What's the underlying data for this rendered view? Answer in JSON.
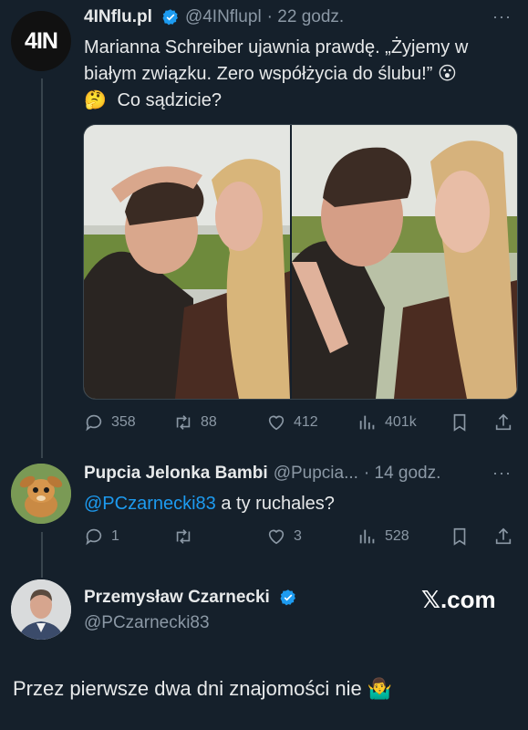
{
  "colors": {
    "background": "#15202b",
    "text": "#e7e9ea",
    "muted": "#8b98a5",
    "accent": "#1d9bf0",
    "thread_line": "#38444d"
  },
  "tweet1": {
    "avatar_text": "4IN",
    "name": "4INflu.pl",
    "verified_icon": "verified-badge-icon",
    "handle": "@4INflupl",
    "time": "· 22 godz.",
    "more": "···",
    "text_line1": "Marianna Schreiber ujawnia prawdę. „Żyjemy w",
    "text_line2": "białym związku. Zero współżycia do ślubu!”",
    "emoji1": "😮",
    "emoji2": "🤔",
    "text_line3": "Co sądzicie?",
    "media_alt": "photo-collage",
    "actions": {
      "replies": "358",
      "retweets": "88",
      "likes": "412",
      "views": "401k"
    }
  },
  "tweet2": {
    "name": "Pupcia Jelonka Bambi",
    "handle": "@Pupcia...",
    "time": "· 14 godz.",
    "more": "···",
    "mention": "@PCzarnecki83",
    "text": " a ty ruchales?",
    "actions": {
      "replies": "1",
      "retweets": "",
      "likes": "3",
      "views": "528"
    }
  },
  "tweet3": {
    "name": "Przemysław Czarnecki",
    "verified_icon": "verified-badge-icon",
    "handle": "@PCzarnecki83",
    "brand": "𝕏.com",
    "text": "Przez pierwsze dwa dni znajomości nie",
    "emoji": "🤷‍♂️"
  }
}
